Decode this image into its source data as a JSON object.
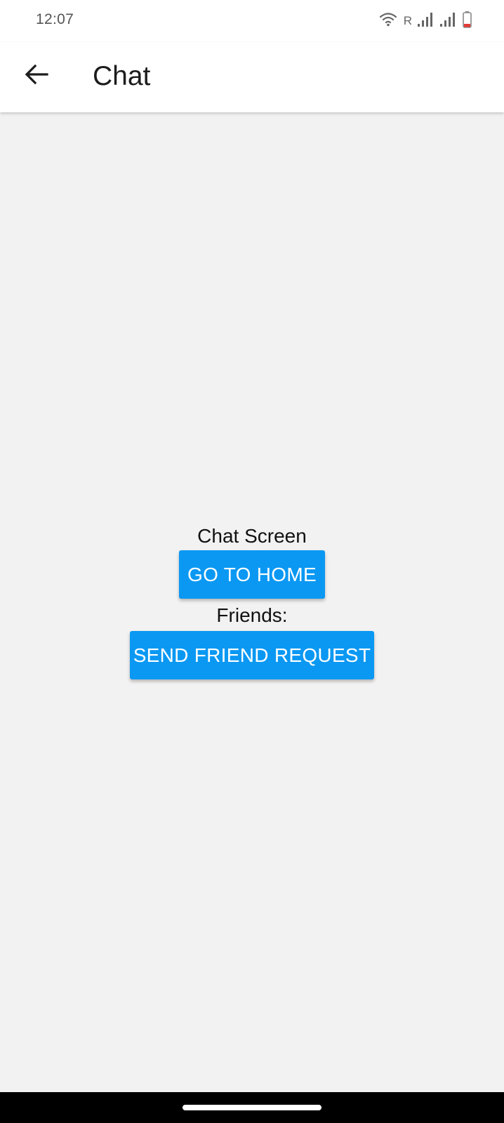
{
  "status_bar": {
    "time": "12:07",
    "roaming_indicator": "R",
    "icons": [
      "wifi-icon",
      "signal-icon",
      "signal-icon",
      "battery-low-icon"
    ],
    "battery_color": "#e53935"
  },
  "app_bar": {
    "title": "Chat",
    "back_icon": "arrow-left-icon"
  },
  "main": {
    "screen_label": "Chat Screen",
    "home_button_label": "GO TO HOME",
    "friends_label": "Friends:",
    "friend_request_button_label": "SEND FRIEND REQUEST"
  },
  "colors": {
    "button": "#0a98f3",
    "background": "#f2f2f2"
  }
}
